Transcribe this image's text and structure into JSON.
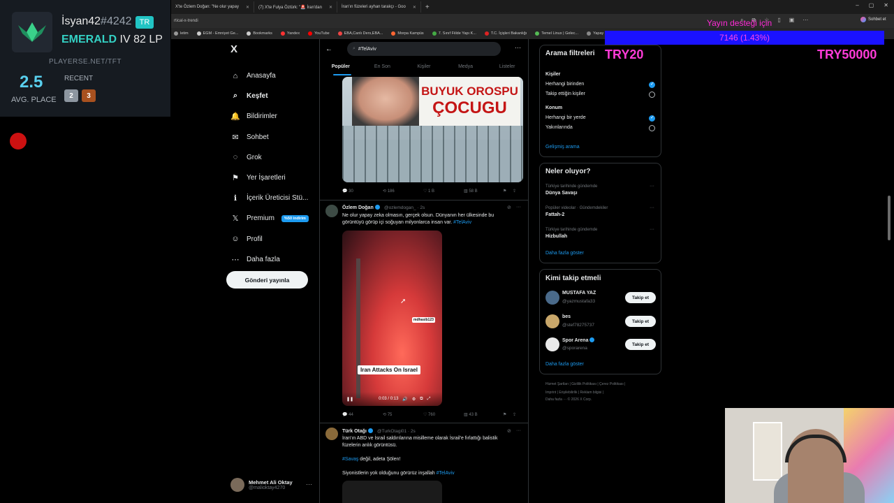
{
  "browser": {
    "tabs": [
      {
        "label": "X'te Özlem Doğan: \"Ne olur yapay"
      },
      {
        "label": "(7) X'te Fulya Öztürk: \"🚨 İran'dan"
      },
      {
        "label": "İran'ın füzeleri ayhan tarakçı - Goo"
      }
    ],
    "new_tab": "+",
    "window_controls": {
      "min": "–",
      "max": "▢",
      "close": "✕"
    },
    "address": "rtical-x-trendi",
    "bookmarks": [
      {
        "label": "letim",
        "color": "#999"
      },
      {
        "label": "EGM - Emniyet Ge...",
        "color": "#ccc"
      },
      {
        "label": "Bookmarks",
        "color": "#ccc"
      },
      {
        "label": "Yandex",
        "color": "#f33"
      },
      {
        "label": "YouTube",
        "color": "#f00"
      },
      {
        "label": "EBA,Canlı Ders,EBA...",
        "color": "#e44"
      },
      {
        "label": "Morpa Kampüs",
        "color": "#f63"
      },
      {
        "label": "7. Sınıf Fiilde Yapı K...",
        "color": "#4a4"
      },
      {
        "label": "T.C. İçişleri Bakanlığı",
        "color": "#d22"
      },
      {
        "label": "Temel Linux | Gelec...",
        "color": "#5b5"
      },
      {
        "label": "Yapay Zek",
        "color": "#888"
      }
    ],
    "right_label": "Sohbet et"
  },
  "overlay": {
    "donation_title": "Yayın desteği için",
    "donation_bar": "7146 (1.43%)",
    "try_left": "TRY20",
    "try_right": "TRY50000"
  },
  "tft": {
    "name": "İsyan42",
    "tag": "#4242",
    "region": "TR",
    "rank_tier": "EMERALD",
    "rank_rest": " IV 82 LP",
    "site": "PLAYERSE.NET/TFT",
    "avg_value": "2.5",
    "avg_label": "AVG. PLACE",
    "recent_label": "RECENT",
    "recent": [
      "2",
      "3"
    ]
  },
  "nav": {
    "logo": "X",
    "items": [
      {
        "label": "Anasayfa",
        "icon": "⌂"
      },
      {
        "label": "Keşfet",
        "icon": "⌕"
      },
      {
        "label": "Bildirimler",
        "icon": "🔔"
      },
      {
        "label": "Sohbet",
        "icon": "✉"
      },
      {
        "label": "Grok",
        "icon": "◌"
      },
      {
        "label": "Yer İşaretleri",
        "icon": "⚑"
      },
      {
        "label": "İçerik Üreticisi Stü...",
        "icon": "ℹ"
      },
      {
        "label": "Premium",
        "icon": "𝕏",
        "badge": "%50 indirim"
      },
      {
        "label": "Profil",
        "icon": "☺"
      },
      {
        "label": "Daha fazla",
        "icon": "⋯"
      }
    ],
    "post_button": "Gönderi yayınla",
    "account_name": "Mehmet Ali Oktay",
    "account_handle": "@malioktay4270",
    "account_more": "···"
  },
  "search": {
    "back": "←",
    "query": "#TelAviv",
    "more": "···",
    "tabs": [
      "Popüler",
      "En Son",
      "Kişiler",
      "Medya",
      "Listeler"
    ]
  },
  "tweet1": {
    "image_text_line1": "BUYUK OROSPU",
    "image_text_line2": "ÇOCUGU",
    "replies": "30",
    "reposts": "186",
    "likes": "1 B",
    "views": "58 B"
  },
  "tweet2": {
    "name": "Özlem Doğan",
    "handle": "@ozlemdogan_ · 2s",
    "text": "Ne olur yapay zeka olmasın, gerçek olsun. Dünyanın her ülkesinde bu görüntüyü görüp içi soğuyan milyonlarca insan var. ",
    "hashtag": "#TelAviv",
    "video_watermark": "mdhasib123",
    "video_caption": "Iran Attacks On Israel",
    "video_time": "0:03 / 0:13",
    "replies": "44",
    "reposts": "75",
    "likes": "760",
    "views": "43 B"
  },
  "tweet3": {
    "name": "Türk Otağı",
    "handle": "@TurkOtagi01 · 2s",
    "text1": "İran'ın ABD ve İsrail saldırılarına misilleme olarak İsrail'e fırlattığı balistik füzelerin anlık görüntüsü.",
    "hashtag_savas": "#Savaş",
    "text2": " değil, adeta Şölen!",
    "text3": "Siyonistlerin yok olduğunu görürüz inşallah ",
    "hashtag_telaviv": "#TelAviv"
  },
  "filters": {
    "title": "Arama filtreleri",
    "people_label": "Kişiler",
    "people_opt1": "Herhangi birinden",
    "people_opt2": "Takip ettiğin kişiler",
    "location_label": "Konum",
    "location_opt1": "Herhangi bir yerde",
    "location_opt2": "Yakınlarında",
    "advanced": "Gelişmiş arama"
  },
  "trends": {
    "title": "Neler oluyor?",
    "items": [
      {
        "context": "Türkiye tarihinde gündemde",
        "name": "Dünya Savaşı"
      },
      {
        "context": "Popüler videolar · Gündemdekiler",
        "name": "Fattah-2"
      },
      {
        "context": "Türkiye tarihinde gündemde",
        "name": "Hizbullah"
      }
    ],
    "show_more": "Daha fazla göster"
  },
  "who": {
    "title": "Kimi takip etmeli",
    "items": [
      {
        "name": "MUSTAFA YAZ",
        "handle": "@yazmustafa33",
        "button": "Takip et"
      },
      {
        "name": "bes",
        "handle": "@stef78275737",
        "button": "Takip et"
      },
      {
        "name": "Spor Arena",
        "handle": "@sporarena",
        "button": "Takip et"
      }
    ],
    "show_more": "Daha fazla göster"
  },
  "footer": {
    "line1": "Hizmet Şartları  |  Gizlilik Politikası  |  Çerez Politikası  |",
    "line2": "Imprint  |  Erişilebilirlik  |  Reklam bilgisi  |",
    "line3": "Daha fazla ···  © 2026 X Corp."
  },
  "colors": {
    "accent": "#1d9bf0",
    "donation_magenta": "#ff2bd6",
    "donation_bar": "#1a12ff",
    "tft_teal": "#34d1c4"
  }
}
